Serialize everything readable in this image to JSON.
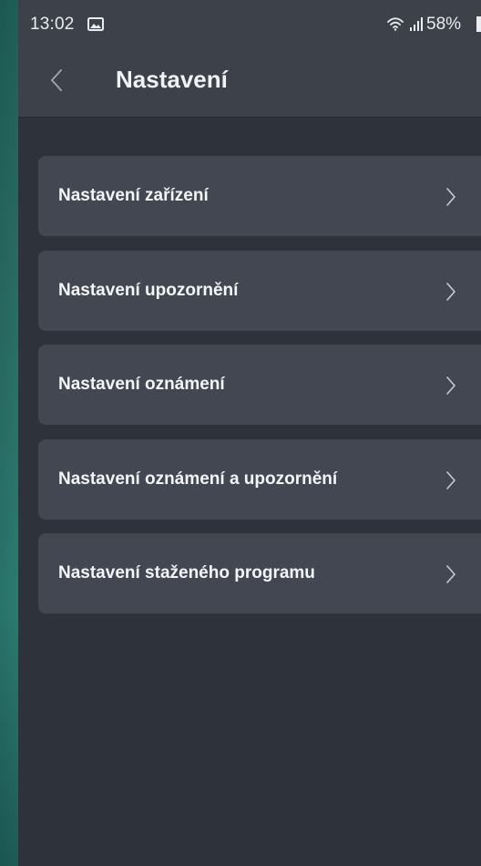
{
  "status_bar": {
    "time": "13:02",
    "battery": "58%",
    "icons": [
      "gallery-icon",
      "wifi-icon",
      "signal-icon",
      "battery-icon"
    ]
  },
  "header": {
    "title": "Nastavení",
    "back_icon": "chevron-left-icon"
  },
  "settings": {
    "items": [
      {
        "label": "Nastavení zařízení",
        "icon": "chevron-right-icon"
      },
      {
        "label": "Nastavení upozornění",
        "icon": "chevron-right-icon"
      },
      {
        "label": "Nastavení oznámení",
        "icon": "chevron-right-icon"
      },
      {
        "label": "Nastavení oznámení a upozornění",
        "icon": "chevron-right-icon"
      },
      {
        "label": "Nastavení staženého programu",
        "icon": "chevron-right-icon"
      }
    ]
  },
  "colors": {
    "backdrop": "#2a6e66",
    "app_background": "#2e323b",
    "header_background": "#3d414a",
    "card_background": "#434751",
    "text": "#f4f5f7",
    "chevron": "#c7cad0"
  }
}
